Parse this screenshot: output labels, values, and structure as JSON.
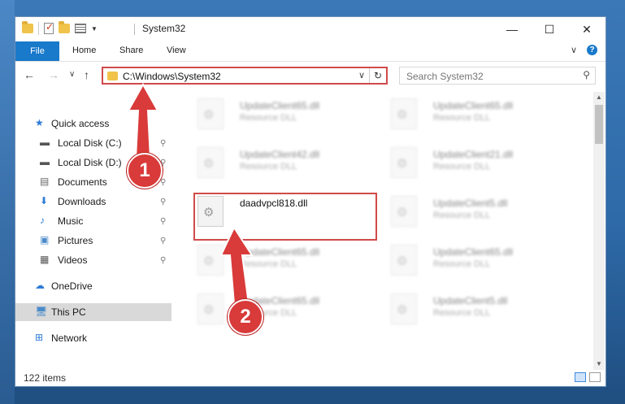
{
  "window": {
    "title": "System32",
    "controls": {
      "minimize": "—",
      "maximize": "☐",
      "close": "✕"
    }
  },
  "ribbon": {
    "file": "File",
    "tabs": [
      "Home",
      "Share",
      "View"
    ],
    "collapse": "∨",
    "help": "?"
  },
  "navigation": {
    "back": "←",
    "forward": "→",
    "recent": "∨",
    "up": "↑",
    "address": "C:\\Windows\\System32",
    "search_placeholder": "Search System32"
  },
  "sidebar": {
    "items": [
      {
        "label": "Quick access",
        "icon": "star-icon",
        "pinned": false,
        "selected": false
      },
      {
        "label": "Local Disk (C:)",
        "icon": "drive-icon",
        "pinned": true,
        "selected": false
      },
      {
        "label": "Local Disk (D:)",
        "icon": "drive-icon",
        "pinned": true,
        "selected": false
      },
      {
        "label": "Documents",
        "icon": "document-icon",
        "pinned": true,
        "selected": false
      },
      {
        "label": "Downloads",
        "icon": "download-icon",
        "pinned": true,
        "selected": false
      },
      {
        "label": "Music",
        "icon": "music-icon",
        "pinned": true,
        "selected": false
      },
      {
        "label": "Pictures",
        "icon": "picture-icon",
        "pinned": true,
        "selected": false
      },
      {
        "label": "Videos",
        "icon": "video-icon",
        "pinned": true,
        "selected": false
      },
      {
        "label": "OneDrive",
        "icon": "cloud-icon",
        "pinned": false,
        "selected": false
      },
      {
        "label": "This PC",
        "icon": "computer-icon",
        "pinned": false,
        "selected": true
      },
      {
        "label": "Network",
        "icon": "network-icon",
        "pinned": false,
        "selected": false
      }
    ],
    "pin_glyph": "📌"
  },
  "files": [
    {
      "name": "UpdateClient65.dll",
      "type": "Resource DLL",
      "blurred": true
    },
    {
      "name": "UpdateClient65.dll",
      "type": "Resource DLL",
      "blurred": true
    },
    {
      "name": "UpdateClient42.dll",
      "type": "Resource DLL",
      "blurred": true
    },
    {
      "name": "UpdateClient21.dll",
      "type": "Resource DLL",
      "blurred": true
    },
    {
      "name": "daadvpcl818.dll",
      "type": "",
      "blurred": false
    },
    {
      "name": "UpdateClient5.dll",
      "type": "Resource DLL",
      "blurred": true
    },
    {
      "name": "UpdateClient65.dll",
      "type": "Resource DLL",
      "blurred": true
    },
    {
      "name": "UpdateClient65.dll",
      "type": "Resource DLL",
      "blurred": true
    },
    {
      "name": "UpdateClient65.dll",
      "type": "Resource DLL",
      "blurred": true
    },
    {
      "name": "UpdateClient5.dll",
      "type": "Resource DLL",
      "blurred": true
    }
  ],
  "status": {
    "item_count": "122 items"
  },
  "annotations": {
    "step1": "1",
    "step2": "2",
    "color": "#d93a3a"
  }
}
